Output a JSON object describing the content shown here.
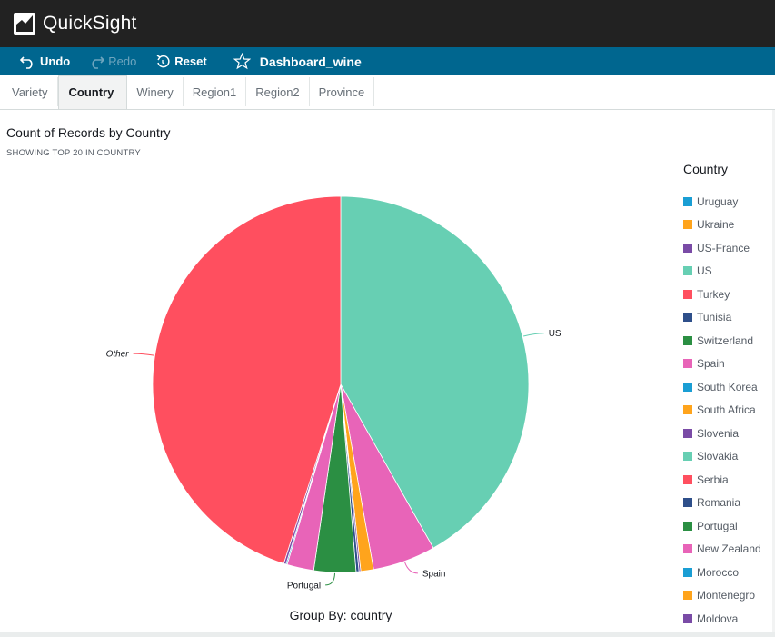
{
  "app": {
    "name": "QuickSight"
  },
  "toolbar": {
    "undo_label": "Undo",
    "redo_label": "Redo",
    "reset_label": "Reset",
    "dashboard_title": "Dashboard_wine"
  },
  "tabs": [
    {
      "label": "Variety",
      "active": false
    },
    {
      "label": "Country",
      "active": true
    },
    {
      "label": "Winery",
      "active": false
    },
    {
      "label": "Region1",
      "active": false
    },
    {
      "label": "Region2",
      "active": false
    },
    {
      "label": "Province",
      "active": false
    }
  ],
  "visual": {
    "title": "Count of Records by Country",
    "subtitle": "SHOWING TOP 20 IN COUNTRY",
    "group_by": "Group By: country"
  },
  "legend": {
    "title": "Country",
    "items": [
      {
        "label": "Uruguay",
        "color": "#1a9ed4"
      },
      {
        "label": "Ukraine",
        "color": "#ffa41c"
      },
      {
        "label": "US-France",
        "color": "#7a4ba6"
      },
      {
        "label": "US",
        "color": "#67cfb3"
      },
      {
        "label": "Turkey",
        "color": "#ff4f5f"
      },
      {
        "label": "Tunisia",
        "color": "#2e4f8a"
      },
      {
        "label": "Switzerland",
        "color": "#2b8f43"
      },
      {
        "label": "Spain",
        "color": "#e864b8"
      },
      {
        "label": "South Korea",
        "color": "#1a9ed4"
      },
      {
        "label": "South Africa",
        "color": "#ffa41c"
      },
      {
        "label": "Slovenia",
        "color": "#7a4ba6"
      },
      {
        "label": "Slovakia",
        "color": "#67cfb3"
      },
      {
        "label": "Serbia",
        "color": "#ff4f5f"
      },
      {
        "label": "Romania",
        "color": "#2e4f8a"
      },
      {
        "label": "Portugal",
        "color": "#2b8f43"
      },
      {
        "label": "New Zealand",
        "color": "#e864b8"
      },
      {
        "label": "Morocco",
        "color": "#1a9ed4"
      },
      {
        "label": "Montenegro",
        "color": "#ffa41c"
      },
      {
        "label": "Moldova",
        "color": "#7a4ba6"
      }
    ]
  },
  "chart_data": {
    "type": "pie",
    "title": "Count of Records by Country",
    "subtitle": "SHOWING TOP 20 IN COUNTRY",
    "slices": [
      {
        "label": "US",
        "value": 41.8,
        "color": "#67cfb3",
        "labeled": true
      },
      {
        "label": "Spain",
        "value": 5.4,
        "color": "#e864b8",
        "labeled": true
      },
      {
        "label": "South Africa",
        "value": 1.1,
        "color": "#ffa41c",
        "labeled": false
      },
      {
        "label": "Slovenia",
        "value": 0.15,
        "color": "#7a4ba6",
        "labeled": false
      },
      {
        "label": "Romania",
        "value": 0.25,
        "color": "#2e4f8a",
        "labeled": false
      },
      {
        "label": "Portugal",
        "value": 3.6,
        "color": "#2b8f43",
        "labeled": true
      },
      {
        "label": "New Zealand",
        "value": 2.3,
        "color": "#e864b8",
        "labeled": false
      },
      {
        "label": "Morocco",
        "value": 0.1,
        "color": "#1a9ed4",
        "labeled": false
      },
      {
        "label": "Moldova",
        "value": 0.2,
        "color": "#7a4ba6",
        "labeled": false
      },
      {
        "label": "Other",
        "value": 45.1,
        "color": "#ff4f5f",
        "labeled": true
      }
    ],
    "legend_position": "right"
  }
}
